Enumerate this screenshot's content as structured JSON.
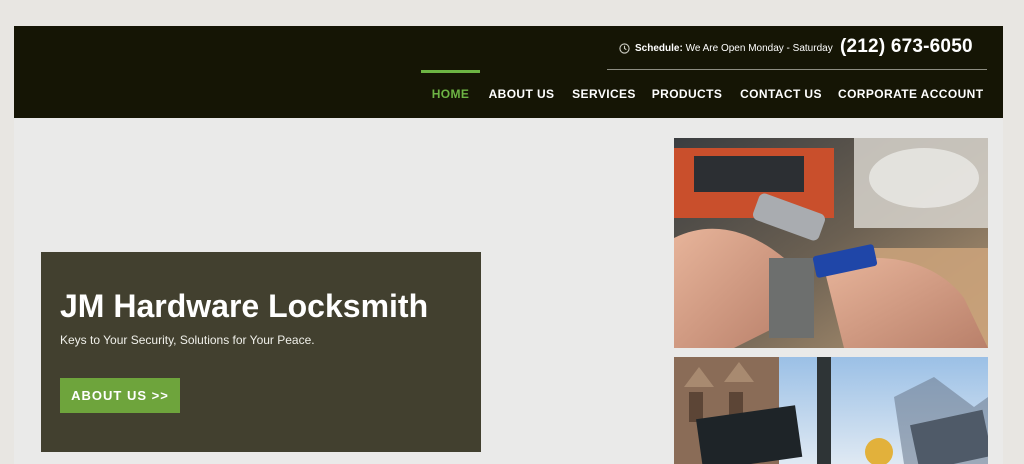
{
  "header": {
    "schedule_label": "Schedule:",
    "schedule_text": " We Are Open Monday - Saturday",
    "phone": "(212) 673-6050"
  },
  "nav": {
    "items": [
      {
        "label": "HOME",
        "active": true
      },
      {
        "label": "ABOUT US"
      },
      {
        "label": "SERVICES"
      },
      {
        "label": "PRODUCTS"
      },
      {
        "label": "CONTACT US"
      },
      {
        "label": "CORPORATE ACCOUNT"
      }
    ]
  },
  "hero": {
    "title": "JM Hardware Locksmith",
    "subtitle": "Keys to Your Security, Solutions for Your Peace.",
    "button_label": "ABOUT US >>"
  },
  "colors": {
    "header_bg": "#151505",
    "accent_green": "#6db444",
    "hero_box_bg": "#42402f",
    "button_green": "#6ea43c"
  },
  "images": [
    {
      "name": "key-cutting-photo"
    },
    {
      "name": "street-sign-photo"
    }
  ]
}
